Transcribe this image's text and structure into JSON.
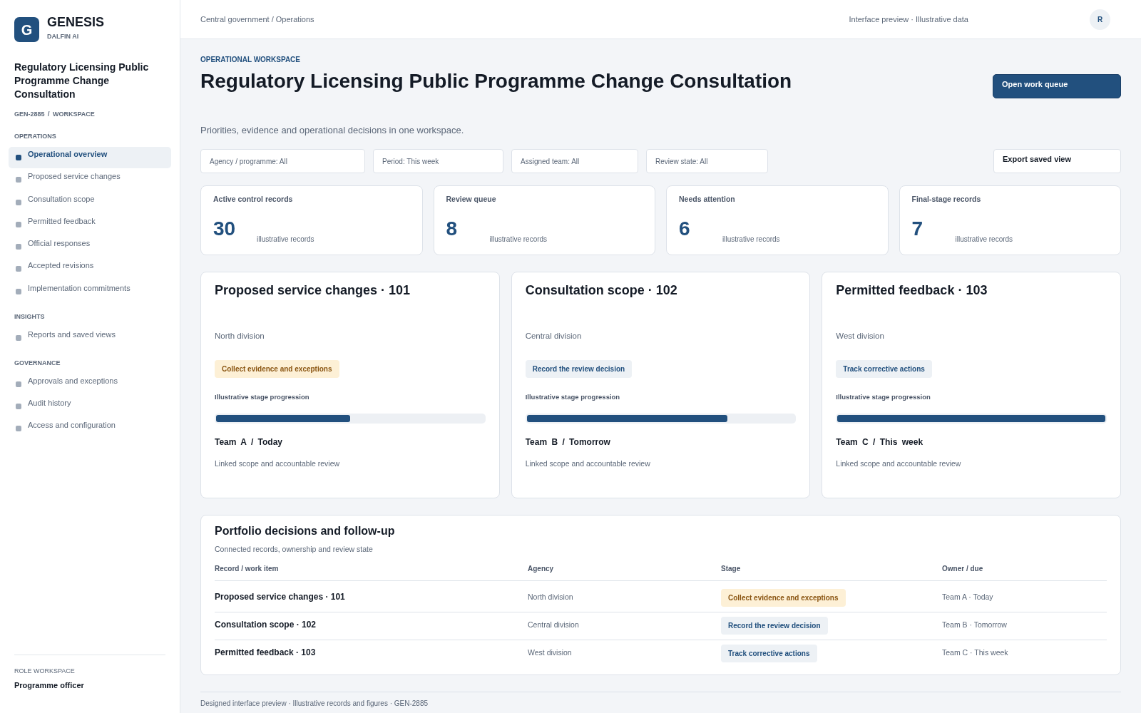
{
  "brand": {
    "logo": "G",
    "name": "GENESIS",
    "tagline": "DALFIN AI"
  },
  "sidebar": {
    "title": "Regulatory Licensing Public Programme Change Consultation",
    "crumb": "GEN-2885 / WORKSPACE",
    "sections": [
      {
        "heading": "OPERATIONS",
        "items": [
          {
            "label": "Operational overview",
            "selected": true
          },
          {
            "label": "Proposed service changes",
            "selected": false
          },
          {
            "label": "Consultation scope",
            "selected": false
          },
          {
            "label": "Permitted feedback",
            "selected": false
          },
          {
            "label": "Official responses",
            "selected": false
          },
          {
            "label": "Accepted revisions",
            "selected": false
          },
          {
            "label": "Implementation commitments",
            "selected": false
          }
        ]
      },
      {
        "heading": "INSIGHTS",
        "items": [
          {
            "label": "Reports and saved views",
            "selected": false
          }
        ]
      },
      {
        "heading": "GOVERNANCE",
        "items": [
          {
            "label": "Approvals and exceptions",
            "selected": false
          },
          {
            "label": "Audit history",
            "selected": false
          },
          {
            "label": "Access and configuration",
            "selected": false
          }
        ]
      }
    ],
    "role": {
      "label": "ROLE WORKSPACE",
      "name": "Programme officer"
    }
  },
  "header": {
    "breadcrumb": "Central government / Operations",
    "note": "Interface preview · Illustrative data",
    "avatar": "R"
  },
  "page": {
    "eyebrow": "OPERATIONAL WORKSPACE",
    "title": "Regulatory Licensing Public Programme Change Consultation",
    "primary_action": "Open work queue",
    "subtitle": "Priorities, evidence and operational decisions in one workspace.",
    "filters": [
      "Agency / programme: All",
      "Period: This week",
      "Assigned team: All",
      "Review state: All"
    ],
    "export_action": "Export saved view"
  },
  "stats": [
    {
      "label": "Active control records",
      "value": "30",
      "caption": "illustrative records"
    },
    {
      "label": "Review queue",
      "value": "8",
      "caption": "illustrative records"
    },
    {
      "label": "Needs attention",
      "value": "6",
      "caption": "illustrative records"
    },
    {
      "label": "Final-stage records",
      "value": "7",
      "caption": "illustrative records"
    }
  ],
  "cards": [
    {
      "title": "Proposed service changes · 101",
      "division": "North division",
      "stage": {
        "label": "Collect evidence and exceptions",
        "kind": "attention"
      },
      "progress_label": "Illustrative stage progression",
      "level": 0.5,
      "owner_due": "Team A / Today",
      "note": "Linked scope and accountable review"
    },
    {
      "title": "Consultation scope · 102",
      "division": "Central division",
      "stage": {
        "label": "Record the review decision",
        "kind": "neutral"
      },
      "progress_label": "Illustrative stage progression",
      "level": 0.75,
      "owner_due": "Team B / Tomorrow",
      "note": "Linked scope and accountable review"
    },
    {
      "title": "Permitted feedback · 103",
      "division": "West division",
      "stage": {
        "label": "Track corrective actions",
        "kind": "neutral"
      },
      "progress_label": "Illustrative stage progression",
      "level": 1,
      "owner_due": "Team C / This week",
      "note": "Linked scope and accountable review"
    }
  ],
  "table": {
    "title": "Portfolio decisions and follow-up",
    "subtitle": "Connected records, ownership and review state",
    "columns": [
      "Record / work item",
      "Agency",
      "Stage",
      "Owner / due"
    ],
    "rows": [
      {
        "record": "Proposed service changes · 101",
        "agency": "North division",
        "stage": {
          "label": "Collect evidence and exceptions",
          "kind": "attention"
        },
        "owner_due": "Team A · Today"
      },
      {
        "record": "Consultation scope · 102",
        "agency": "Central division",
        "stage": {
          "label": "Record the review decision",
          "kind": "neutral"
        },
        "owner_due": "Team B · Tomorrow"
      },
      {
        "record": "Permitted feedback · 103",
        "agency": "West division",
        "stage": {
          "label": "Track corrective actions",
          "kind": "neutral"
        },
        "owner_due": "Team C · This week"
      }
    ]
  },
  "footer": "Designed interface preview · Illustrative records and figures · GEN-2885"
}
